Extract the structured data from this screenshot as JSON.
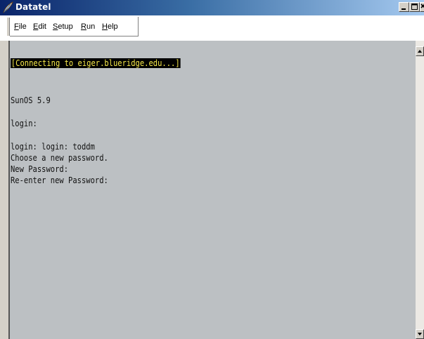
{
  "window": {
    "title": "Datatel",
    "controls": [
      "minimize",
      "maximize",
      "close"
    ]
  },
  "menubar": {
    "items": [
      {
        "key": "F",
        "rest": "ile",
        "label": "File"
      },
      {
        "key": "E",
        "rest": "dit",
        "label": "Edit"
      },
      {
        "key": "S",
        "rest": "etup",
        "label": "Setup"
      },
      {
        "key": "R",
        "rest": "un",
        "label": "Run"
      },
      {
        "key": "H",
        "rest": "elp",
        "label": "Help"
      }
    ]
  },
  "terminal": {
    "highlight_line": "[Connecting to eiger.blueridge.edu...]",
    "lines": [
      "SunOS 5.9",
      "login:",
      "login: login: toddm",
      "Choose a new password.",
      "New Password:",
      "Re-enter new Password:"
    ],
    "colors": {
      "background": "#bcc0c3",
      "text": "#111111",
      "highlight_bg": "#000000",
      "highlight_fg": "#f5e74a"
    }
  },
  "icons": {
    "app": "datatel-feather-icon",
    "scroll_up": "scroll-up-arrow-icon",
    "scroll_down": "scroll-down-arrow-icon"
  }
}
